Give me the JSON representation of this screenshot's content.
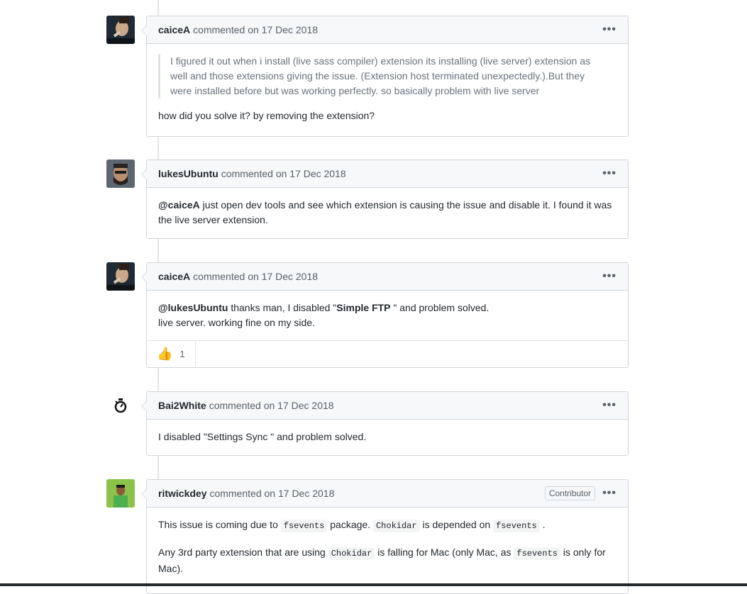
{
  "header_more": "•••",
  "comments": [
    {
      "author": "caiceA",
      "meta": "commented on 17 Dec 2018",
      "quote": "I figured it out when i install (live sass compiler) extension its installing (live server) extension as well and those extensions giving the issue. (Extension host terminated unexpectedly.).But they were installed before but was working perfectly. so basically problem with live server",
      "body": "how did you solve it? by removing the extension?"
    },
    {
      "author": "lukesUbuntu",
      "meta": "commented on 17 Dec 2018",
      "mention": "@caiceA",
      "body": " just open dev tools and see which extension is causing the issue and disable it. I found it was the live server extension."
    },
    {
      "author": "caiceA",
      "meta": "commented on 17 Dec 2018",
      "mention": "@lukesUbuntu",
      "body_part1": " thanks man, I disabled \"",
      "bold": "Simple FTP",
      "body_part2": " \" and problem solved.",
      "body_line2": "live server. working fine on my side.",
      "reaction_icon": "thumbs-up-icon",
      "reaction_count": "1"
    },
    {
      "author": "Bai2White",
      "meta": "commented on 17 Dec 2018",
      "body": "I disabled \"Settings Sync \" and problem solved."
    },
    {
      "author": "ritwickdey",
      "meta": "commented on 17 Dec 2018",
      "badge": "Contributor",
      "p1_a": "This issue is coming due to ",
      "code1": "fsevents",
      "p1_b": " package. ",
      "code2": "Chokidar",
      "p1_c": " is depended on ",
      "code3": "fsevents",
      "p1_d": " .",
      "p2_a": "Any 3rd party extension that are using ",
      "code4": "Chokidar",
      "p2_b": " is falling for Mac (only Mac, as ",
      "code5": "fsevents",
      "p2_c": " is only for Mac)."
    }
  ]
}
